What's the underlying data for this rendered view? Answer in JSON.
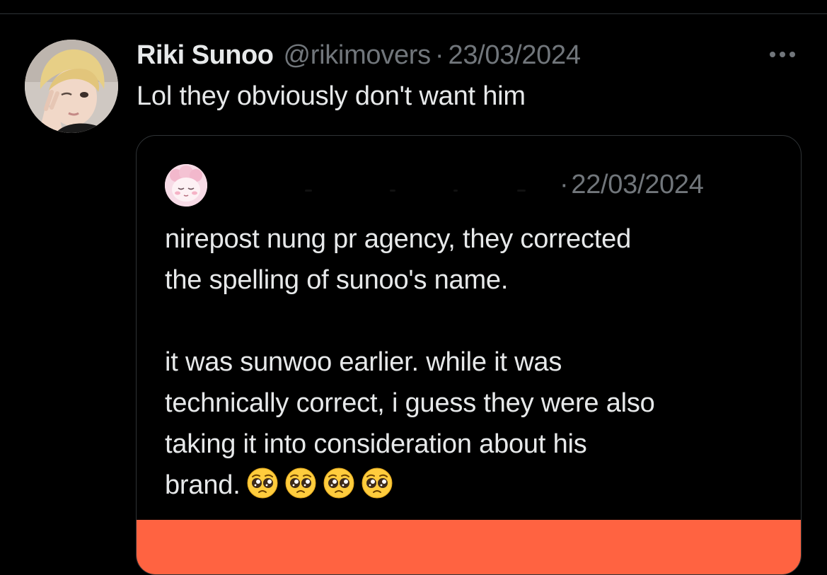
{
  "tweet": {
    "display_name": "Riki Sunoo",
    "handle": "@rikimovers",
    "separator": "·",
    "date": "23/03/2024",
    "text": "Lol they obviously don't want him"
  },
  "quoted_tweet": {
    "separator": "·",
    "date": "22/03/2024",
    "paragraph_1": "nirepost nung pr agency, they corrected\nthe spelling of sunoo's name.",
    "paragraph_2": "it was sunwoo earlier. while it was\ntechnically correct, i guess they were also\ntaking it into consideration about his\nbrand.",
    "emoji_count": 4,
    "emoji_name": "pleading-face"
  },
  "icons": {
    "more": "more-horizontal-icon"
  },
  "colors": {
    "background": "#000000",
    "primary_text": "#e7e9ea",
    "secondary_text": "#71767b",
    "border": "#2f3336",
    "media_strip": "#ff6341"
  }
}
